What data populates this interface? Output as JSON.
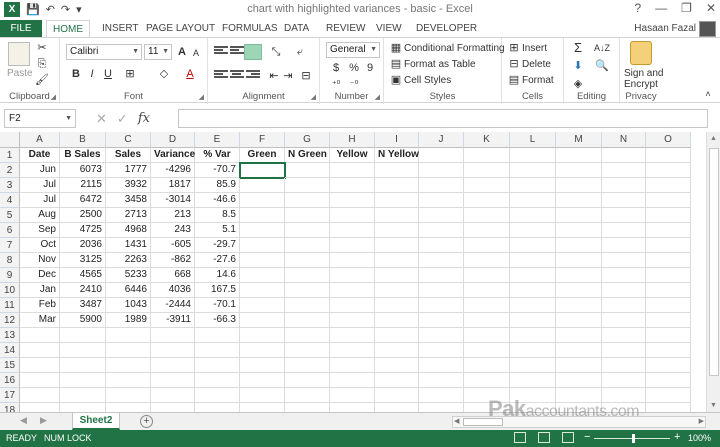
{
  "window": {
    "title": "chart with highlighted variances - basic - Excel",
    "app_logo": "X",
    "controls": [
      "?",
      "—",
      "❐",
      "✕"
    ],
    "user": "Hasaan Fazal"
  },
  "tabs": [
    "FILE",
    "HOME",
    "INSERT",
    "PAGE LAYOUT",
    "FORMULAS",
    "DATA",
    "REVIEW",
    "VIEW",
    "DEVELOPER"
  ],
  "ribbon": {
    "clipboard": {
      "label": "Clipboard",
      "paste": "Paste"
    },
    "font": {
      "label": "Font",
      "name": "Calibri",
      "size": "11",
      "bold": "B",
      "italic": "I",
      "underline": "U",
      "grow": "A",
      "shrink": "A",
      "font_color": "A"
    },
    "alignment": {
      "label": "Alignment"
    },
    "number": {
      "label": "Number",
      "format": "General",
      "currency": "$",
      "percent": "%",
      "comma": "9"
    },
    "styles": {
      "label": "Styles",
      "conditional": "Conditional Formatting",
      "table": "Format as Table",
      "cell_styles": "Cell Styles"
    },
    "cells": {
      "label": "Cells",
      "insert": "Insert",
      "delete": "Delete",
      "format": "Format"
    },
    "editing": {
      "label": "Editing"
    },
    "privacy": {
      "label": "Privacy",
      "sign1": "Sign and",
      "sign2": "Encrypt"
    }
  },
  "formula_bar": {
    "name_box": "F2",
    "fx": "fx",
    "value": ""
  },
  "columns": [
    "A",
    "B",
    "C",
    "D",
    "E",
    "F",
    "G",
    "H",
    "I",
    "J",
    "K",
    "L",
    "M",
    "N",
    "O"
  ],
  "rows": [
    "1",
    "2",
    "3",
    "4",
    "5",
    "6",
    "7",
    "8",
    "9",
    "10",
    "11",
    "12",
    "13",
    "14",
    "15",
    "16",
    "17",
    "18"
  ],
  "headers": [
    "Date",
    "B Sales",
    "Sales",
    "Variance",
    "% Var",
    "Green",
    "N Green",
    "Yellow",
    "N Yellow"
  ],
  "table": [
    [
      "Jun",
      "6073",
      "1777",
      "-4296",
      "-70.7"
    ],
    [
      "Jul",
      "2115",
      "3932",
      "1817",
      "85.9"
    ],
    [
      "Jul",
      "6472",
      "3458",
      "-3014",
      "-46.6"
    ],
    [
      "Aug",
      "2500",
      "2713",
      "213",
      "8.5"
    ],
    [
      "Sep",
      "4725",
      "4968",
      "243",
      "5.1"
    ],
    [
      "Oct",
      "2036",
      "1431",
      "-605",
      "-29.7"
    ],
    [
      "Nov",
      "3125",
      "2263",
      "-862",
      "-27.6"
    ],
    [
      "Dec",
      "4565",
      "5233",
      "668",
      "14.6"
    ],
    [
      "Jan",
      "2410",
      "6446",
      "4036",
      "167.5"
    ],
    [
      "Feb",
      "3487",
      "1043",
      "-2444",
      "-70.1"
    ],
    [
      "Mar",
      "5900",
      "1989",
      "-3911",
      "-66.3"
    ]
  ],
  "selected_cell": "F2",
  "sheet": {
    "name": "Sheet2",
    "add": "+"
  },
  "status": {
    "ready": "READY",
    "numlock": "NUM LOCK",
    "zoom": "100%"
  },
  "watermark": {
    "big": "Pak",
    "small": "accountants.com"
  },
  "colors": {
    "accent": "#217346"
  }
}
